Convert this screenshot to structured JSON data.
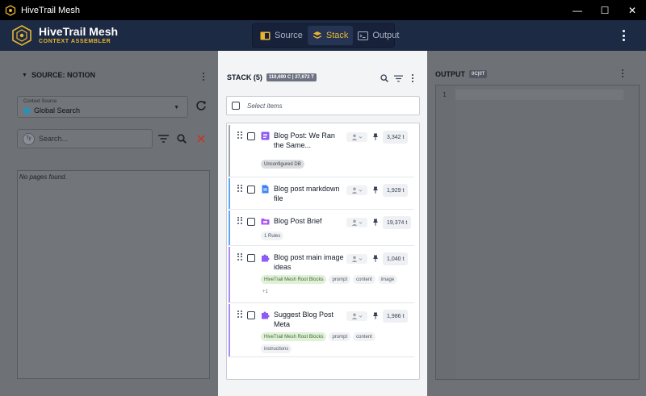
{
  "window": {
    "title": "HiveTrail Mesh"
  },
  "brand": {
    "name": "HiveTrail Mesh",
    "subtitle": "CONTEXT ASSEMBLER"
  },
  "modes": [
    {
      "label": "Source",
      "active": false
    },
    {
      "label": "Stack",
      "active": true
    },
    {
      "label": "Output",
      "active": false
    }
  ],
  "source_panel": {
    "title": "SOURCE: NOTION",
    "context_label": "Context Source",
    "context_value": "Global Search",
    "search_avatar": "Ty",
    "search_placeholder": "Search...",
    "empty_text": "No pages found."
  },
  "stack_panel": {
    "title": "STACK (5)",
    "badge": "110,690 C | 27,672 T",
    "select_label": "Select items",
    "items": [
      {
        "title": "Blog Post: We Ran the Same...",
        "tokens": "3,342 t",
        "icon": "notion-page-icon",
        "tags": [
          {
            "label": "Unconfigured DB",
            "style": "gray"
          }
        ]
      },
      {
        "title": "Blog post markdown file",
        "tokens": "1,929 t",
        "icon": "file-icon",
        "tags": []
      },
      {
        "title": "Blog Post Brief",
        "tokens": "19,374 t",
        "icon": "folder-icon",
        "tags": [
          {
            "label": "1 Rules",
            "style": ""
          }
        ]
      },
      {
        "title": "Blog post main image ideas",
        "tokens": "1,040 t",
        "icon": "puzzle-icon",
        "tags": [
          {
            "label": "HiveTrail Mesh Root Blocks",
            "style": "green"
          },
          {
            "label": "prompt",
            "style": ""
          },
          {
            "label": "content",
            "style": ""
          },
          {
            "label": "image",
            "style": ""
          },
          {
            "label": "+1",
            "style": "more"
          }
        ]
      },
      {
        "title": "Suggest Blog Post Meta",
        "tokens": "1,986 t",
        "icon": "puzzle-icon",
        "tags": [
          {
            "label": "HiveTrail Mesh Root Blocks",
            "style": "green"
          },
          {
            "label": "prompt",
            "style": ""
          },
          {
            "label": "content",
            "style": ""
          },
          {
            "label": "instructions",
            "style": ""
          }
        ]
      }
    ]
  },
  "output_panel": {
    "title": "OUTPUT",
    "badge": "0C|0T",
    "line_number": "1"
  },
  "colors": {
    "header_bg": "#1d2a44",
    "accent": "#e8b531",
    "bar_gray": "#a0a4aa",
    "bar_blue": "#60a5fa",
    "bar_purple": "#a78bfa",
    "icon_purple": "#8b5cf6",
    "icon_blue": "#3b82f6"
  }
}
